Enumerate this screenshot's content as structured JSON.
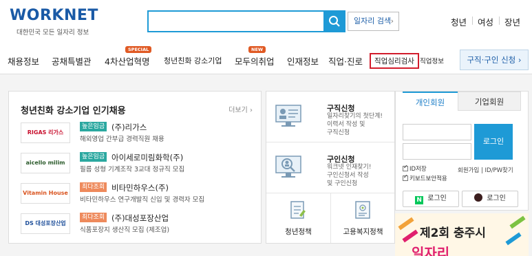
{
  "header": {
    "logo_text": "WORKNET",
    "logo_subtitle": "대한민국 모든 일자리 정보",
    "search_placeholder": "",
    "job_search_label": "일자리 검색",
    "quick_links": [
      "청년",
      "여성",
      "장년"
    ]
  },
  "nav": {
    "items": [
      {
        "label": "채용정보"
      },
      {
        "label": "공채특별관"
      },
      {
        "label": "4차산업혁명",
        "badge": "SPECIAL"
      },
      {
        "label": "청년친화 강소기업"
      },
      {
        "label": "모두의취업",
        "badge": "NEW"
      },
      {
        "label": "인재정보"
      },
      {
        "label": "직업·진로"
      },
      {
        "label": "직업심리검사"
      },
      {
        "label": "직업정보"
      }
    ],
    "cta_label": "구직·구인 신청"
  },
  "featured": {
    "title": "청년친화 강소기업 인기채용",
    "more_label": "더보기",
    "jobs": [
      {
        "logo": "RIGAS 리가스",
        "tag": "높은임금",
        "company": "(주)리가스",
        "desc": "해외영업 간부급 경력직원 채용"
      },
      {
        "logo": "aicello milim",
        "tag": "높은임금",
        "company": "아이세로미림화학(주)",
        "desc": "필름 성형 기계조작 3교대 정규직 모집"
      },
      {
        "logo": "Vitamin House",
        "tag": "최다조회",
        "company": "비타민하우스(주)",
        "desc": "비타민하우스 연구개발직 신입 및 경력자 모집"
      },
      {
        "logo": "DS 대성포장산업",
        "tag": "최다조회",
        "company": "(주)대성포장산업",
        "desc": "식품포장지 생산직 모집 (제조업)"
      }
    ]
  },
  "services": {
    "rows": [
      {
        "title": "구직신청",
        "desc": [
          "일자리찾기의 첫단계!",
          "이력서 작성 및",
          "구직신청"
        ]
      },
      {
        "title": "구인신청",
        "desc": [
          "워크넷 인재찾기!",
          "구인신청서 작성",
          "및 구인신청"
        ]
      }
    ],
    "bottom": [
      "청년정책",
      "고용복지정책"
    ]
  },
  "login": {
    "tab_personal": "개인회원",
    "tab_company": "기업회원",
    "login_button": "로그인",
    "save_id": "ID저장",
    "keyboard_security": "키보드보안적용",
    "links": "회원가입 | ID/PW찾기",
    "naver_login": "로그인",
    "kakao_login": "로그인"
  },
  "banner": {
    "title": "제2회 충주시",
    "subtitle": "일자리"
  },
  "colors": {
    "primary": "#1e9ad6",
    "brand_green": "#7cc242",
    "highlight_red": "#d21c2b",
    "tag_green": "#2ba8a0",
    "tag_orange": "#ee8a5c"
  }
}
